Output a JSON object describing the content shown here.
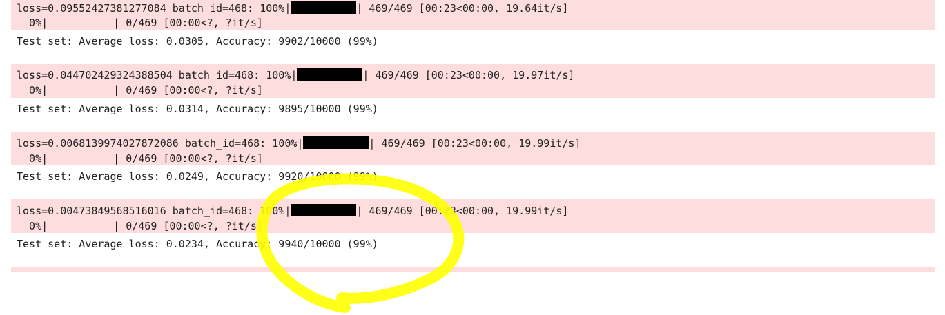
{
  "cells": [
    {
      "progress_prefix": "loss=0.09552427381277084 batch_id=468: 100%|",
      "progress_suffix": "| 469/469 [00:23<00:00, 19.64it/s]",
      "progress_fraction": 1.0,
      "next_prefix": "  0%|",
      "next_suffix": "| 0/469 [00:00<?, ?it/s]",
      "test_line": "Test set: Average loss: 0.0305, Accuracy: 9902/10000 (99%)"
    },
    {
      "progress_prefix": "loss=0.044702429324388504 batch_id=468: 100%|",
      "progress_suffix": "| 469/469 [00:23<00:00, 19.97it/s]",
      "progress_fraction": 1.0,
      "next_prefix": "  0%|",
      "next_suffix": "| 0/469 [00:00<?, ?it/s]",
      "test_line": "Test set: Average loss: 0.0314, Accuracy: 9895/10000 (99%)"
    },
    {
      "progress_prefix": "loss=0.0068139974027872086 batch_id=468: 100%|",
      "progress_suffix": "| 469/469 [00:23<00:00, 19.99it/s]",
      "progress_fraction": 1.0,
      "next_prefix": "  0%|",
      "next_suffix": "| 0/469 [00:00<?, ?it/s]",
      "test_line": "Test set: Average loss: 0.0249, Accuracy: 9920/10000 (99%)"
    },
    {
      "progress_prefix": "loss=0.00473849568516016 batch_id=468: 100%|",
      "progress_suffix": "| 469/469 [00:23<00:00, 19.99it/s]",
      "progress_fraction": 1.0,
      "next_prefix": "  0%|",
      "next_suffix": "| 0/469 [00:00<?, ?it/s]",
      "test_line": "Test set: Average loss: 0.0234, Accuracy: 9940/10000 (99%)"
    }
  ],
  "colors": {
    "stderr_bg": "#fddddd",
    "highlight": "#ffff00",
    "bar": "#000000"
  }
}
